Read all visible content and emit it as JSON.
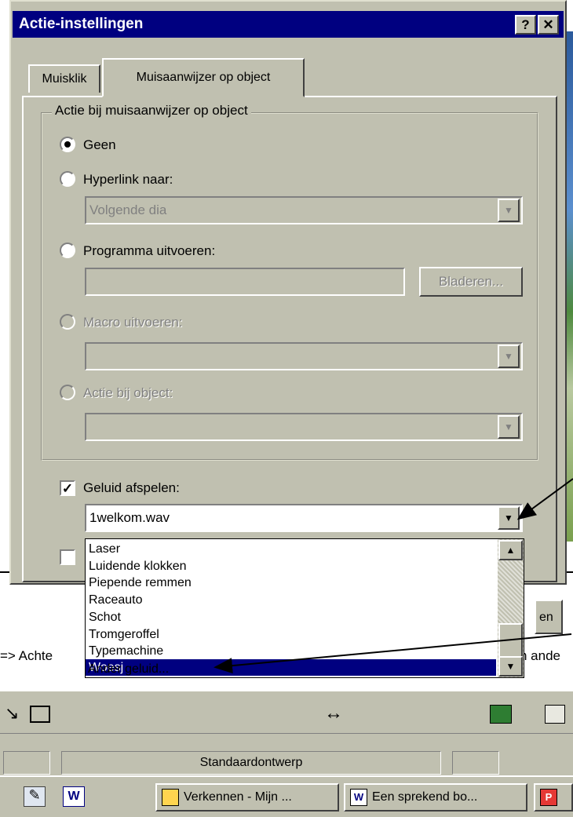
{
  "dialog": {
    "title": "Actie-instellingen",
    "help_label": "?",
    "close_label": "✕",
    "tabs": [
      "Muisklik",
      "Muisaanwijzer op object"
    ],
    "group_label": "Actie bij muisaanwijzer op object",
    "options": {
      "none": "Geen",
      "hyperlink": "Hyperlink naar:",
      "run_program": "Programma uitvoeren:",
      "run_macro": "Macro uitvoeren:",
      "object_action": "Actie bij object:"
    },
    "hyperlink_value": "Volgende dia",
    "browse_label": "Bladeren...",
    "play_sound_label": "Geluid afspelen:",
    "sound_value": "1welkom.wav",
    "selected_option": "none",
    "play_sound_checked": true,
    "ok_partial": "en"
  },
  "sound_list": {
    "items": [
      "Laser",
      "Luidende klokken",
      "Piepende remmen",
      "Raceauto",
      "Schot",
      "Tromgeroffel",
      "Typemachine",
      "Woesj",
      "Ander geluid..."
    ],
    "selected": "Woesj"
  },
  "document": {
    "hint_left": "=> Achte",
    "hint_right": "n ande"
  },
  "statusbar": {
    "design": "Standaardontwerp"
  },
  "taskbar": {
    "buttons": [
      "Verkennen - Mijn ...",
      "Een sprekend bo..."
    ]
  },
  "colors": {
    "title_bg": "#000080",
    "face": "#c0c0b0",
    "selection": "#000080"
  }
}
